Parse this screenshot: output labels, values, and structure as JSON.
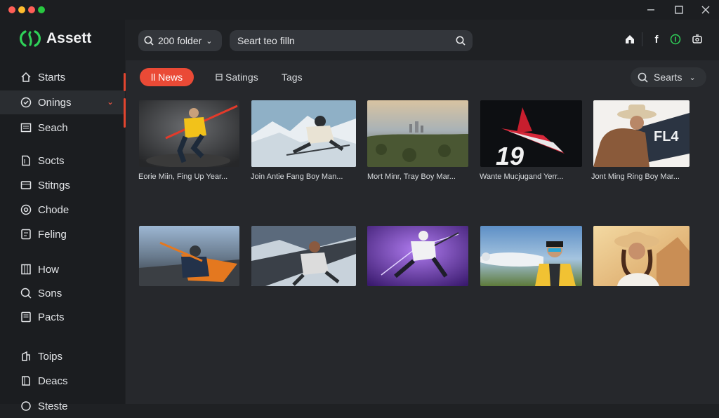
{
  "app": {
    "name": "Assett"
  },
  "window": {
    "controls": [
      "minimize",
      "maximize",
      "close"
    ]
  },
  "header": {
    "folder_picker": "200 folder",
    "search_placeholder": "Seart teo filln",
    "icons": [
      "home-icon",
      "facebook-icon",
      "status-icon",
      "settings-icon"
    ]
  },
  "sidebar": {
    "items": [
      {
        "label": "Starts",
        "icon": "home-icon"
      },
      {
        "label": "Onings",
        "icon": "clock-icon",
        "active": true
      },
      {
        "label": "Seach",
        "icon": "list-icon"
      },
      {
        "label": "Socts",
        "icon": "doc-icon"
      },
      {
        "label": "Stitngs",
        "icon": "card-icon"
      },
      {
        "label": "Chode",
        "icon": "record-icon"
      },
      {
        "label": "Feling",
        "icon": "tag-icon"
      },
      {
        "label": "How",
        "icon": "grid-icon"
      },
      {
        "label": "Sons",
        "icon": "search-doc-icon"
      },
      {
        "label": "Pacts",
        "icon": "folder-icon"
      },
      {
        "label": "Toips",
        "icon": "tools-icon"
      },
      {
        "label": "Deacs",
        "icon": "book-icon"
      },
      {
        "label": "Steste",
        "icon": "star-icon"
      }
    ]
  },
  "tabs": [
    {
      "label": "ll News",
      "active": true
    },
    {
      "label": "Satings",
      "active": false
    },
    {
      "label": "Tags",
      "active": false
    }
  ],
  "right_search": {
    "label": "Searts"
  },
  "thumbnails": [
    {
      "caption": "Eorie Miin, Fing Up Year...",
      "scene": "athlete-jump"
    },
    {
      "caption": "Join Antie Fang Boy Man...",
      "scene": "skier-mountain"
    },
    {
      "caption": "Mort Minr, Tray Boy Mar...",
      "scene": "aerial-city"
    },
    {
      "caption": "Wante Mucjugand Yerr...",
      "scene": "red-jet-19"
    },
    {
      "caption": "Jont Ming Ring Boy Mar...",
      "scene": "cowboy-flag"
    },
    {
      "caption": "",
      "scene": "racer-runway"
    },
    {
      "caption": "",
      "scene": "skier-glide"
    },
    {
      "caption": "",
      "scene": "fighter-purple"
    },
    {
      "caption": "",
      "scene": "pilot-plane"
    },
    {
      "caption": "",
      "scene": "woman-desert"
    }
  ],
  "colors": {
    "accent": "#ea4a36",
    "logo": "#2fd158",
    "sidebar_bg": "#1b1d20",
    "main_bg": "#26282c"
  }
}
